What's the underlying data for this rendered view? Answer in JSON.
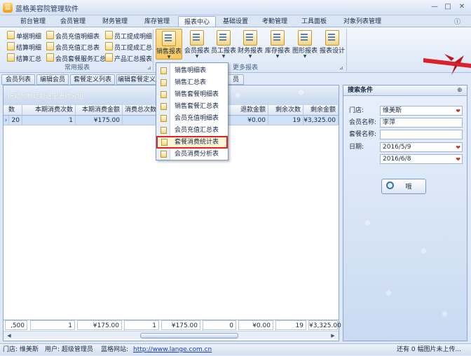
{
  "app": {
    "title": "蓝格美容院管理软件"
  },
  "menu_tabs": [
    "前台管理",
    "会员管理",
    "财务管理",
    "库存管理",
    "报表中心",
    "基础设置",
    "考勤管理",
    "工具面板",
    "对象列表管理"
  ],
  "active_tab": "报表中心",
  "ribbon": {
    "common_reports": {
      "label": "常用报表",
      "items": [
        "单据明细",
        "会员充值明细表",
        "员工提成明细",
        "结算明细",
        "会员充值汇总表",
        "员工提成汇总",
        "结算汇总",
        "会员套餐服务汇总",
        "产品汇总报表"
      ]
    },
    "more_reports": {
      "label": "更多报表",
      "buttons": [
        "销售报表",
        "会员报表",
        "员工报表",
        "财务报表",
        "库存报表",
        "图形报表",
        "报表设计"
      ]
    }
  },
  "doc_tabs": [
    "会员列表",
    "编辑会员",
    "套餐定义列表",
    "编辑套餐定义",
    "员"
  ],
  "grid": {
    "group_hint": "拖动列标题到这里进行分组",
    "columns": [
      "数",
      "本期消费次数",
      "本期消费金额",
      "消费总次数",
      "退款金额",
      "剩余次数",
      "剩余金额"
    ],
    "row": {
      "count": "20",
      "period_times": "1",
      "period_amount": "¥175.00",
      "refund": "¥0.00",
      "remain_times": "19",
      "remain_amount": "¥3,325.00"
    },
    "totals": {
      "count": ",500",
      "period_times": "1",
      "period_amount": "¥175.00",
      "total_times": "1",
      "total_amount": "¥175.00",
      "zero": "0",
      "refund": "¥0.00",
      "remain_times": "19",
      "remain_amount": "¥3,325.00"
    }
  },
  "dropdown": {
    "items": [
      "销售明细表",
      "销售汇总表",
      "销售套餐明细表",
      "销售套餐汇总表",
      "会员充值明细表",
      "会员充值汇总表",
      "套餐消费统计表",
      "会员消费分析表"
    ],
    "highlighted": "套餐消费统计表"
  },
  "search": {
    "title": "搜索条件",
    "fields": [
      {
        "label": "门店:",
        "value": "维美斯"
      },
      {
        "label": "会员名称:",
        "value": "李萍"
      },
      {
        "label": "套餐名称:",
        "value": ""
      },
      {
        "label": "日期:",
        "value": "2016/5/9"
      },
      {
        "label": "",
        "value": "2016/6/8"
      }
    ],
    "button": "哦"
  },
  "status": {
    "store": "门店: 维美斯",
    "user": "用户: 超级管理员",
    "site_label": "蓝格网站:",
    "site_url": "http://www.lange.com.cn",
    "upload": "还有 0 幅图片未上传..."
  }
}
